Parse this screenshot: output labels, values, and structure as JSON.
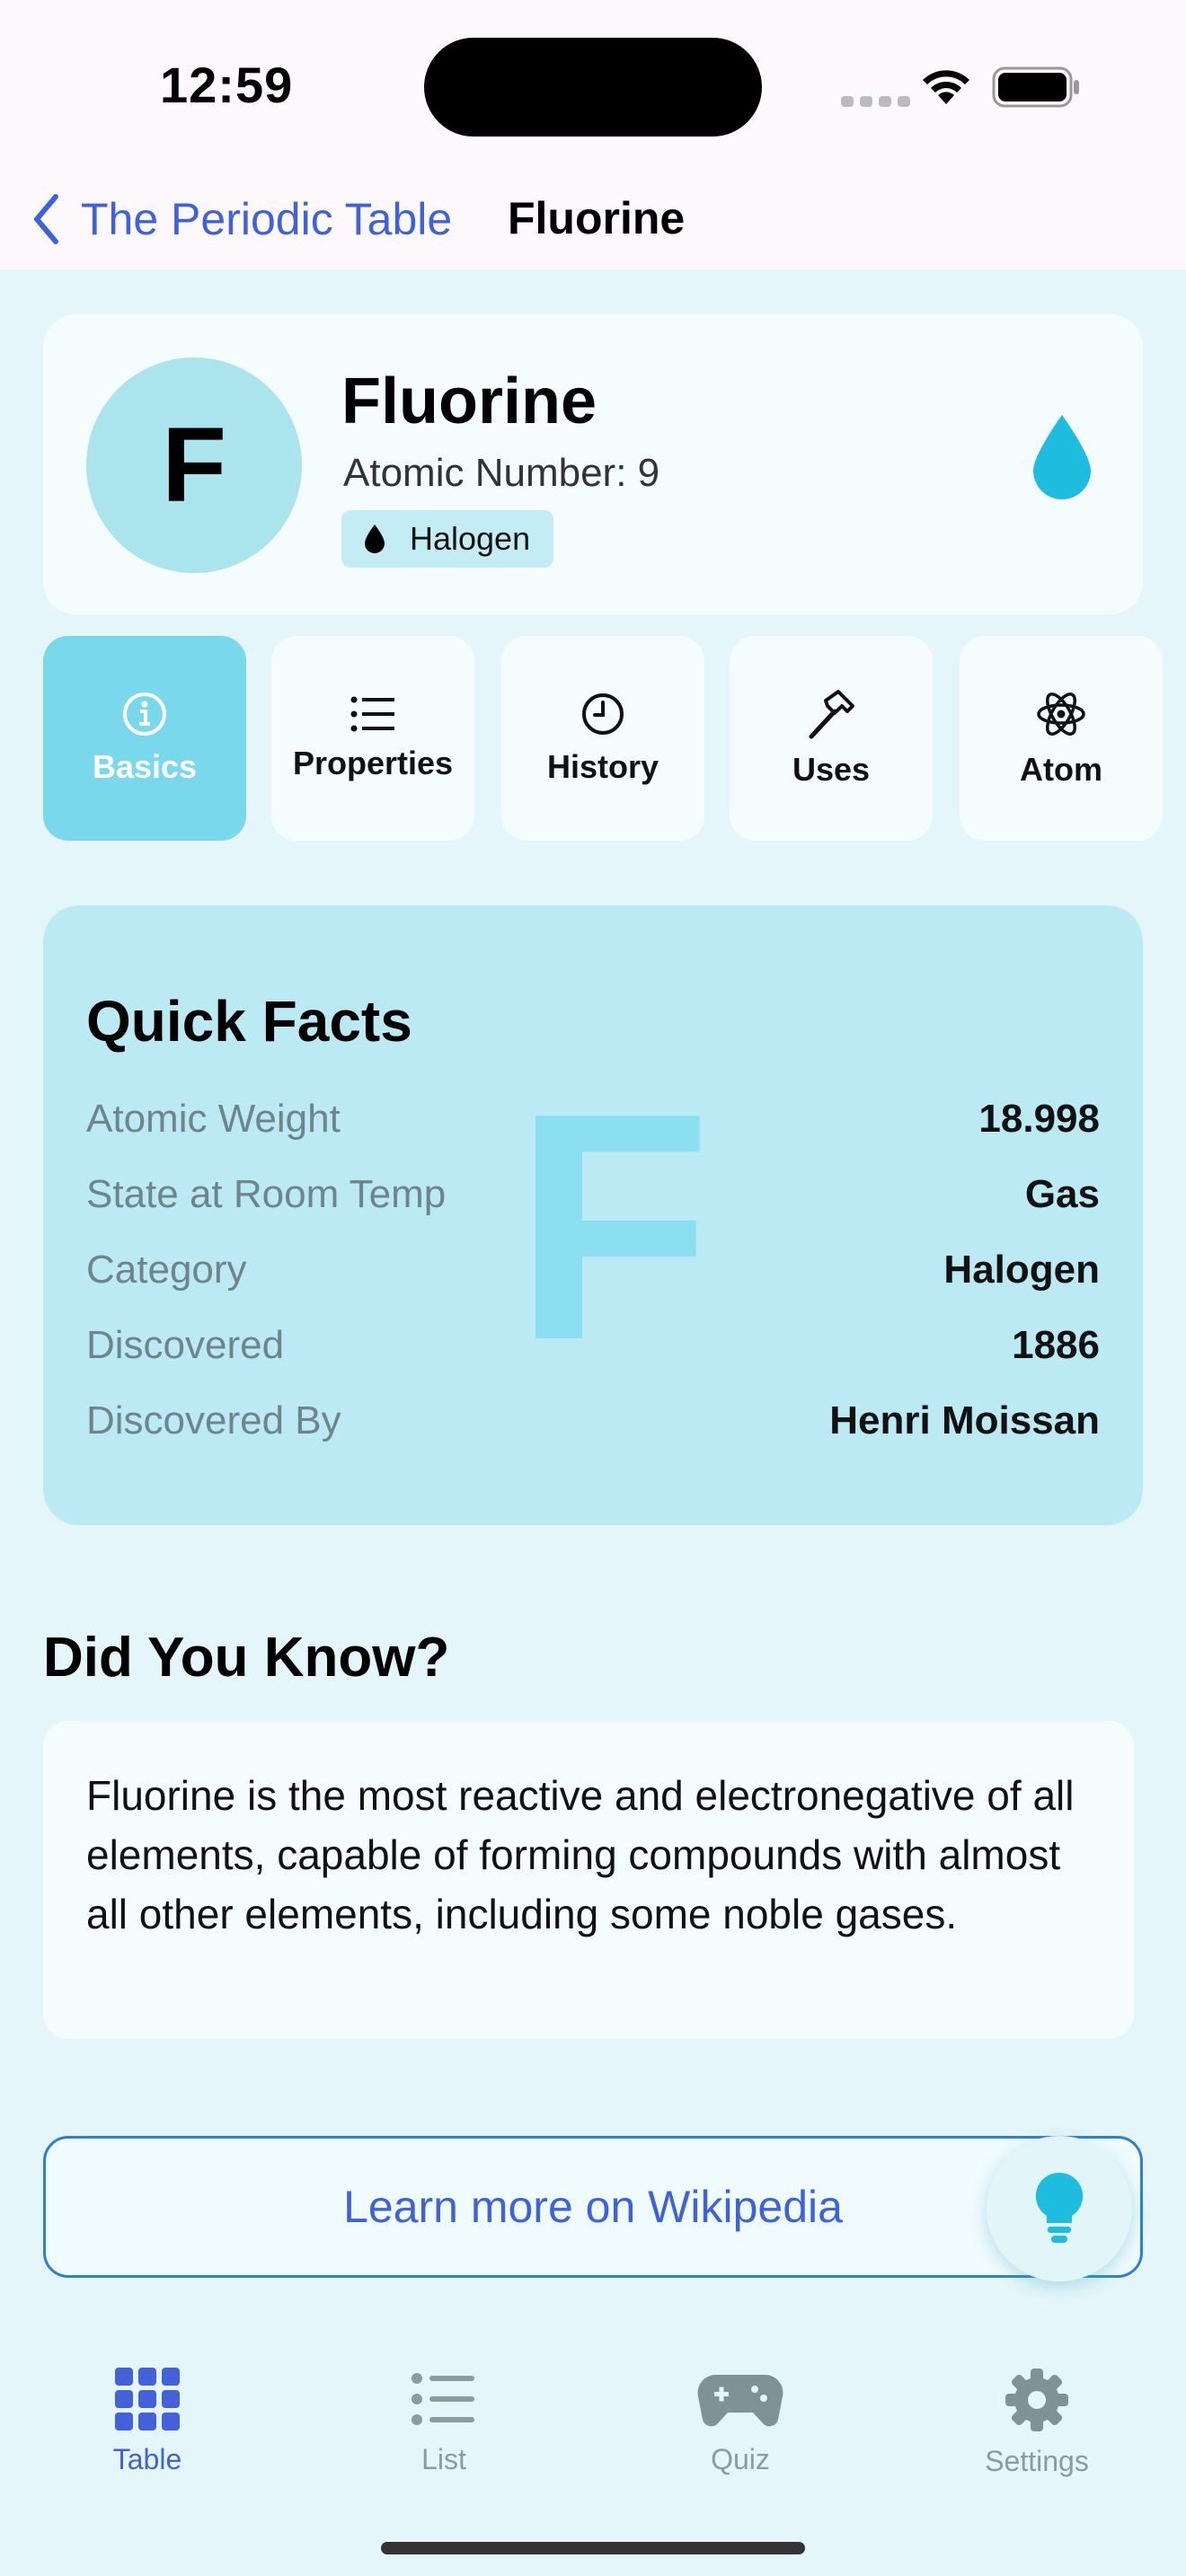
{
  "status_bar": {
    "time": "12:59"
  },
  "nav": {
    "back_label": "The Periodic Table",
    "title": "Fluorine"
  },
  "element": {
    "symbol": "F",
    "name": "Fluorine",
    "atomic_number_text": "Atomic Number: 9",
    "category": "Halogen",
    "category_icon": "drop-icon"
  },
  "tabs": [
    {
      "label": "Basics",
      "icon": "info-icon",
      "active": true
    },
    {
      "label": "Properties",
      "icon": "list-icon",
      "active": false
    },
    {
      "label": "History",
      "icon": "clock-icon",
      "active": false
    },
    {
      "label": "Uses",
      "icon": "hammer-icon",
      "active": false
    },
    {
      "label": "Atom",
      "icon": "atom-icon",
      "active": false
    }
  ],
  "quick_facts": {
    "title": "Quick Facts",
    "watermark": "F",
    "rows": [
      {
        "label": "Atomic Weight",
        "value": "18.998"
      },
      {
        "label": "State at Room Temp",
        "value": "Gas"
      },
      {
        "label": "Category",
        "value": "Halogen"
      },
      {
        "label": "Discovered",
        "value": "1886"
      },
      {
        "label": "Discovered By",
        "value": "Henri Moissan"
      }
    ]
  },
  "did_you_know": {
    "title": "Did You Know?",
    "text": "Fluorine is the most reactive and electronegative of all elements, capable of forming compounds with almost all other elements, including some noble gases."
  },
  "wiki_button_label": "Learn more on Wikipedia",
  "tab_bar": [
    {
      "label": "Table",
      "icon": "grid-icon",
      "active": true
    },
    {
      "label": "List",
      "icon": "list-icon",
      "active": false
    },
    {
      "label": "Quiz",
      "icon": "gamecontroller-icon",
      "active": false
    },
    {
      "label": "Settings",
      "icon": "gear-icon",
      "active": false
    }
  ],
  "colors": {
    "accent": "#4361d9",
    "element_color": "#1ebde0",
    "active_tab": "#79d8ec",
    "background": "#e4f6f9"
  }
}
